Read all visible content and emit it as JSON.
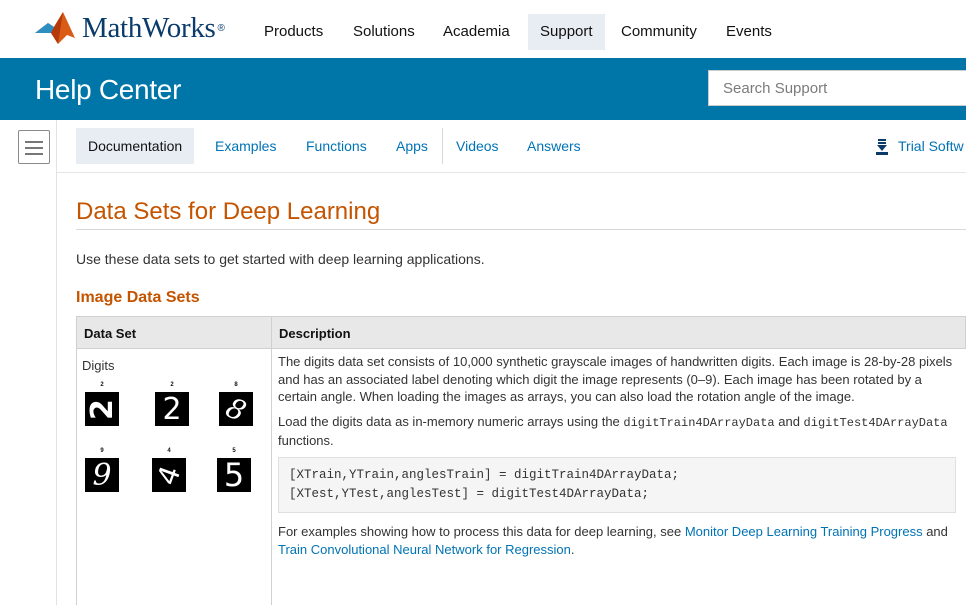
{
  "topnav": {
    "logo_text": "MathWorks",
    "logo_reg": "®",
    "items": [
      "Products",
      "Solutions",
      "Academia",
      "Support",
      "Community",
      "Events"
    ],
    "active": "Support"
  },
  "header": {
    "title": "Help Center",
    "search_placeholder": "Search Support"
  },
  "subnav": {
    "items": [
      "Documentation",
      "Examples",
      "Functions",
      "Apps",
      "Videos",
      "Answers"
    ],
    "active": "Documentation",
    "trial_label": "Trial Softw"
  },
  "icons": {
    "menu": "hamburger-menu-icon",
    "trial": "download-icon",
    "logo": "mathworks-membrane-logo"
  },
  "colors": {
    "brand_blue": "#0076a8",
    "title_orange": "#c45400",
    "link_blue": "#0073b5"
  },
  "page": {
    "title": "Data Sets for Deep Learning",
    "intro": "Use these data sets to get started with deep learning applications.",
    "section_heading": "Image Data Sets"
  },
  "table": {
    "headers": [
      "Data Set",
      "Description"
    ],
    "rows": [
      {
        "dataset": "Digits",
        "digit_labels": [
          "2",
          "2",
          "8",
          "9",
          "4",
          "5"
        ],
        "digit_glyphs": [
          "2",
          "2",
          "8",
          "9",
          "4",
          "5"
        ],
        "desc_p1": "The digits data set consists of 10,000 synthetic grayscale images of handwritten digits. Each image is 28-by-28 pixels and has an associated label denoting which digit the image represents (0–9). Each image has been rotated by a certain angle. When loading the images as arrays, you can also load the rotation angle of the image.",
        "desc_p2_a": "Load the digits data as in-memory numeric arrays using the ",
        "desc_p2_code1": "digitTrain4DArrayData",
        "desc_p2_b": " and ",
        "desc_p2_code2": "digitTest4DArrayData",
        "desc_p2_c": " functions.",
        "code_line1": "[XTrain,YTrain,anglesTrain] = digitTrain4DArrayData;",
        "code_line2": "[XTest,YTest,anglesTest] = digitTest4DArrayData;",
        "desc_p3_a": "For examples showing how to process this data for deep learning, see ",
        "desc_p3_link1": "Monitor Deep Learning Training Progress",
        "desc_p3_b": " and ",
        "desc_p3_link2": "Train Convolutional Neural Network for Regression",
        "desc_p3_c": "."
      }
    ]
  }
}
